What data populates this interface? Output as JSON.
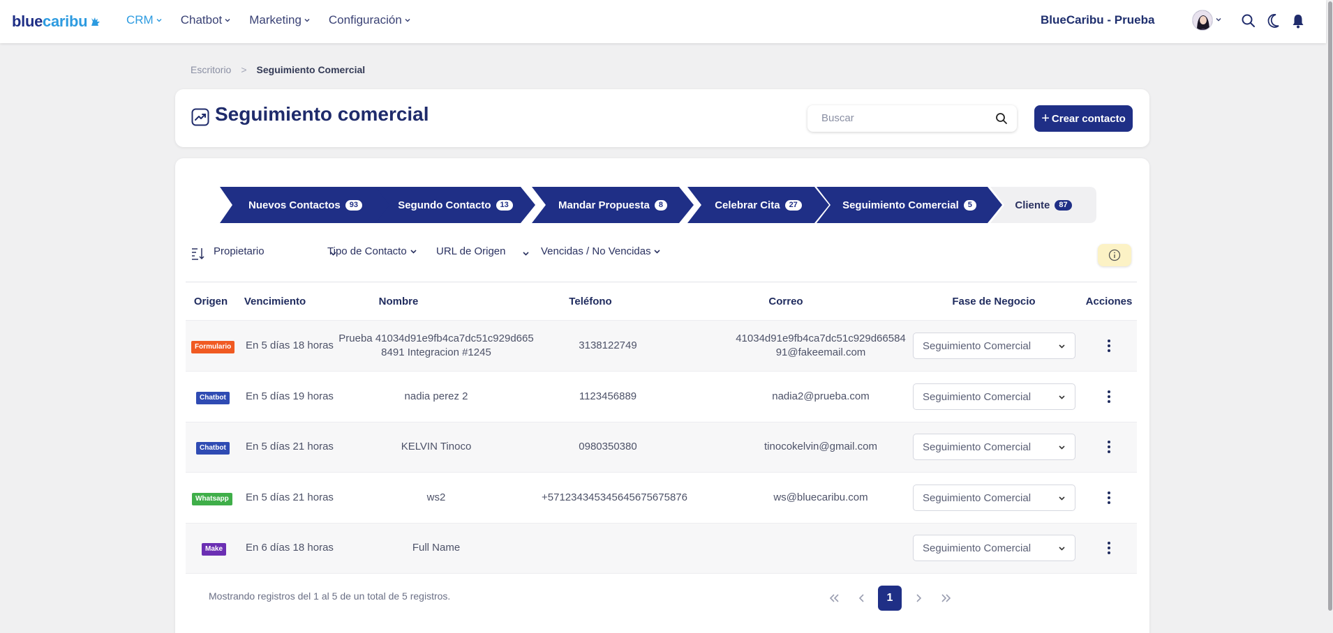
{
  "brand": {
    "logo_part1": "blue",
    "logo_part2": "caribu"
  },
  "nav": {
    "items": [
      {
        "label": "CRM",
        "active": true
      },
      {
        "label": "Chatbot",
        "active": false
      },
      {
        "label": "Marketing",
        "active": false
      },
      {
        "label": "Configuración",
        "active": false
      }
    ],
    "account_name": "BlueCaribu - Prueba"
  },
  "breadcrumb": {
    "home": "Escritorio",
    "separator": ">",
    "current": "Seguimiento Comercial"
  },
  "header": {
    "title": "Seguimiento comercial",
    "search_placeholder": "Buscar",
    "create_button": "Crear contacto"
  },
  "pipeline": {
    "stages": [
      {
        "label": "Nuevos Contactos",
        "count": "93"
      },
      {
        "label": "Segundo Contacto",
        "count": "13"
      },
      {
        "label": "Mandar Propuesta",
        "count": "8"
      },
      {
        "label": "Celebrar Cita",
        "count": "27"
      },
      {
        "label": "Seguimiento Comercial",
        "count": "5"
      },
      {
        "label": "Cliente",
        "count": "87"
      }
    ]
  },
  "filters": {
    "owner": "Propietario",
    "contact_type": "Tipo de Contacto",
    "origin_url": "URL de Origen",
    "due": "Vencidas / No Vencidas"
  },
  "table": {
    "headers": {
      "origin": "Origen",
      "due": "Vencimiento",
      "name": "Nombre",
      "phone": "Teléfono",
      "email": "Correo",
      "stage": "Fase de Negocio",
      "actions": "Acciones"
    },
    "rows": [
      {
        "origin": "Formulario",
        "origin_color": "#f05a22",
        "due": "En 5 días 18 horas",
        "name_l1": "Prueba 41034d91e9fb4ca7dc51c929d665",
        "name_l2": "8491 Integracion #1245",
        "phone": "3138122749",
        "email_l1": "41034d91e9fb4ca7dc51c929d66584",
        "email_l2": "91@fakeemail.com",
        "stage": "Seguimiento Comercial"
      },
      {
        "origin": "Chatbot",
        "origin_color": "#2f4bb3",
        "due": "En 5 días 19 horas",
        "name_l1": "nadia perez 2",
        "name_l2": "",
        "phone": "1123456889",
        "email_l1": "nadia2@prueba.com",
        "email_l2": "",
        "stage": "Seguimiento Comercial"
      },
      {
        "origin": "Chatbot",
        "origin_color": "#2f4bb3",
        "due": "En 5 días 21 horas",
        "name_l1": "KELVIN Tinoco",
        "name_l2": "",
        "phone": "0980350380",
        "email_l1": "tinocokelvin@gmail.com",
        "email_l2": "",
        "stage": "Seguimiento Comercial"
      },
      {
        "origin": "Whatsapp",
        "origin_color": "#3fae49",
        "due": "En 5 días 21 horas",
        "name_l1": "ws2",
        "name_l2": "",
        "phone": "+571234345345645675675876",
        "email_l1": "ws@bluecaribu.com",
        "email_l2": "",
        "stage": "Seguimiento Comercial"
      },
      {
        "origin": "Make",
        "origin_color": "#6b2fb3",
        "due": "En 6 días 18 horas",
        "name_l1": "Full Name",
        "name_l2": "",
        "phone": "",
        "email_l1": "",
        "email_l2": "",
        "stage": "Seguimiento Comercial"
      }
    ]
  },
  "footer": {
    "showing": "Mostrando registros del 1 al 5 de un total de 5 registros.",
    "current_page": "1"
  },
  "colors": {
    "primary": "#1f2f86",
    "accent": "#2d9be0",
    "info_bg": "#fcf2c5"
  }
}
